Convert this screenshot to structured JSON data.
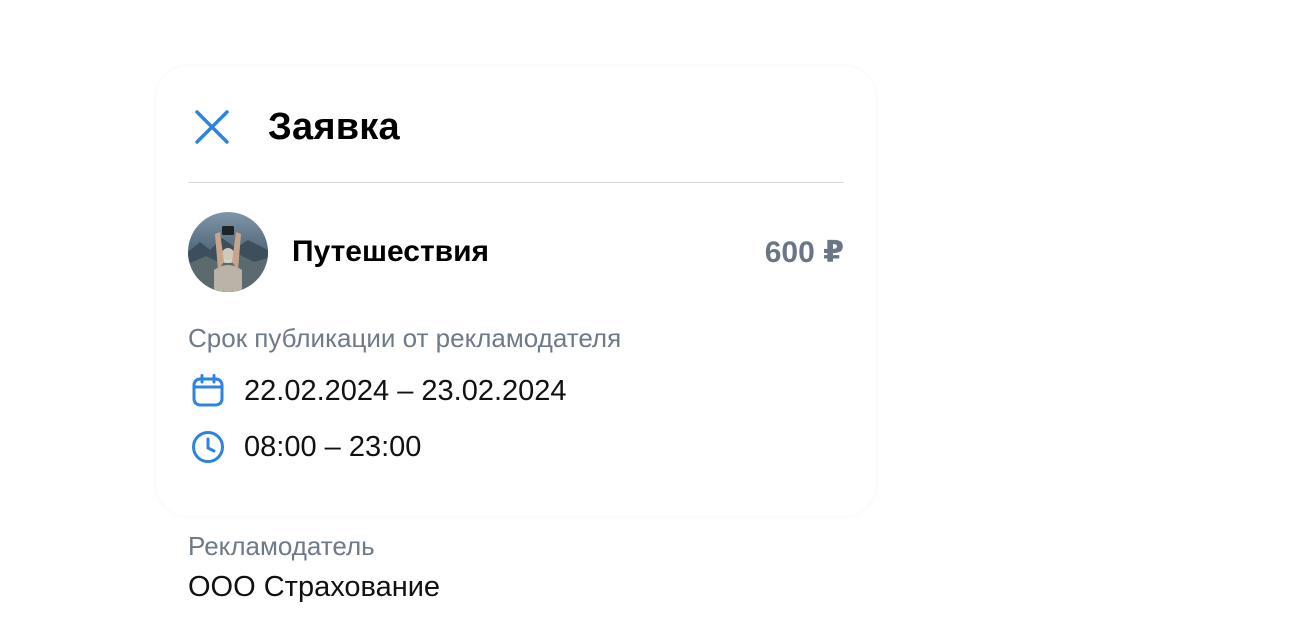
{
  "modal": {
    "title": "Заявка",
    "close_icon": "close-icon"
  },
  "channel": {
    "name": "Путешествия",
    "price": "600 ₽",
    "avatar_icon": "traveler-photo"
  },
  "publication": {
    "label": "Срок публикации от рекламодателя",
    "dates": "22.02.2024 – 23.02.2024",
    "time": "08:00 – 23:00",
    "date_icon": "calendar-icon",
    "time_icon": "clock-icon"
  },
  "advertiser": {
    "label": "Рекламодатель",
    "name": "ООО Страхование"
  },
  "colors": {
    "accent": "#2c83e0",
    "muted": "#6f7a88"
  }
}
